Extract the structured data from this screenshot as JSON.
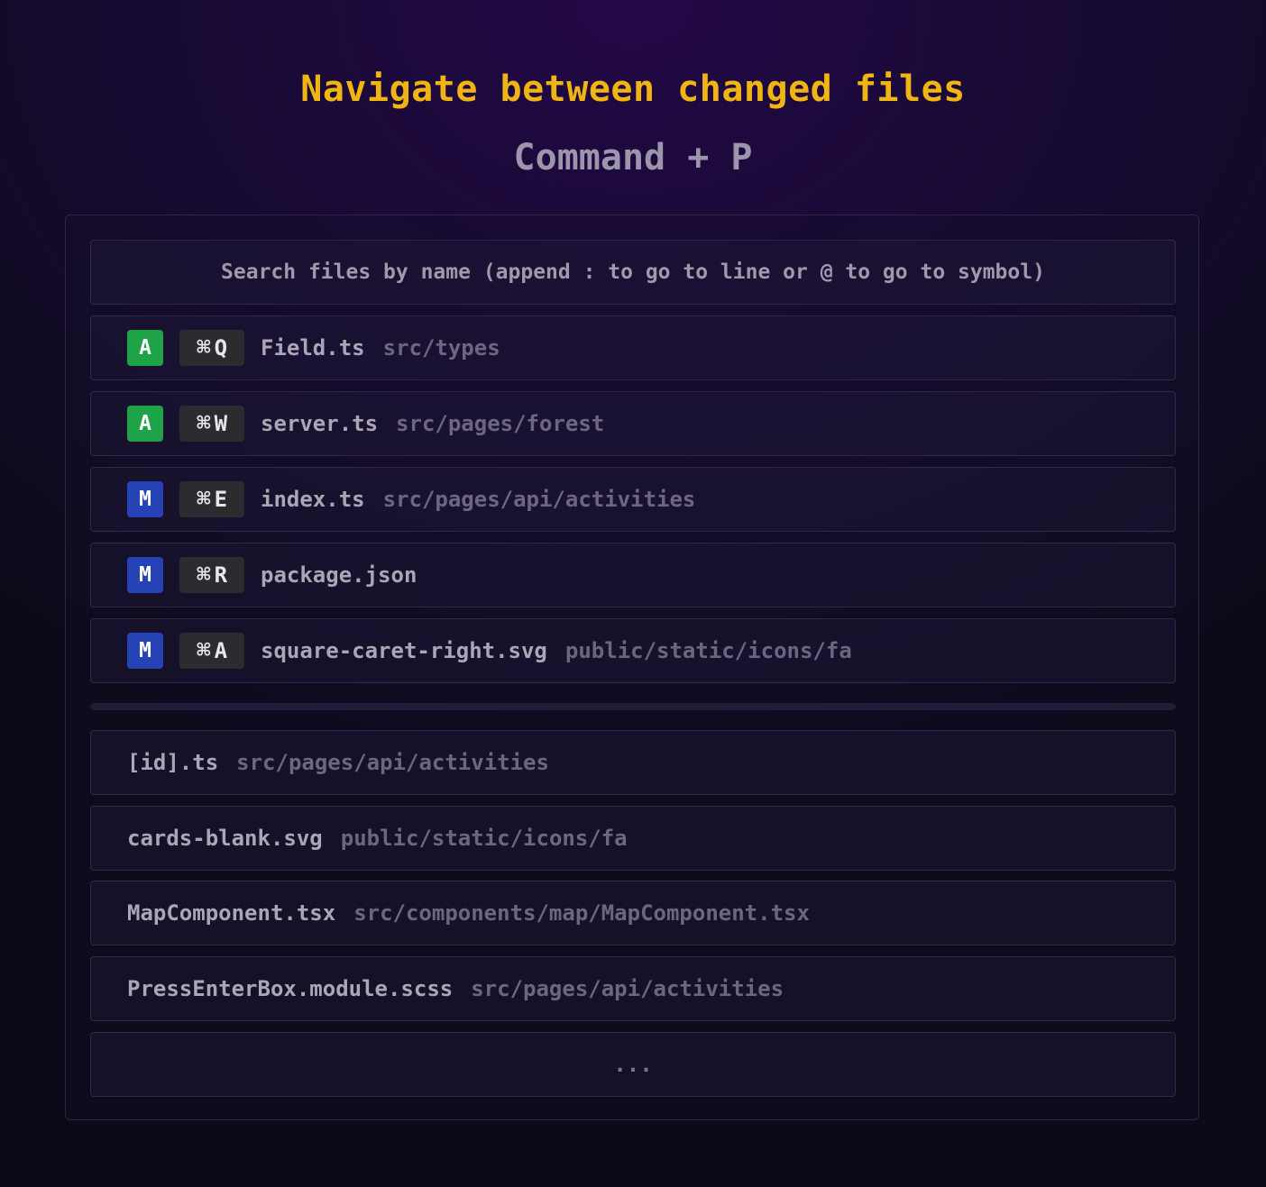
{
  "header": {
    "title": "Navigate between changed files",
    "shortcut": "Command + P"
  },
  "search": {
    "placeholder": "Search files by name (append : to go to line or @ to go to symbol)"
  },
  "changed_files": [
    {
      "status": "A",
      "status_color": "#1fa348",
      "shortcut_symbol": "⌘",
      "shortcut_key": "Q",
      "name": "Field.ts",
      "path": "src/types"
    },
    {
      "status": "A",
      "status_color": "#1fa348",
      "shortcut_symbol": "⌘",
      "shortcut_key": "W",
      "name": "server.ts",
      "path": "src/pages/forest"
    },
    {
      "status": "M",
      "status_color": "#2543b4",
      "shortcut_symbol": "⌘",
      "shortcut_key": "E",
      "name": "index.ts",
      "path": "src/pages/api/activities"
    },
    {
      "status": "M",
      "status_color": "#2543b4",
      "shortcut_symbol": "⌘",
      "shortcut_key": "R",
      "name": "package.json",
      "path": ""
    },
    {
      "status": "M",
      "status_color": "#2543b4",
      "shortcut_symbol": "⌘",
      "shortcut_key": "A",
      "name": "square-caret-right.svg",
      "path": "public/static/icons/fa"
    }
  ],
  "other_files": [
    {
      "name": "[id].ts",
      "path": "src/pages/api/activities"
    },
    {
      "name": "cards-blank.svg",
      "path": "public/static/icons/fa"
    },
    {
      "name": "MapComponent.tsx",
      "path": "src/components/map/MapComponent.tsx"
    },
    {
      "name": "PressEnterBox.module.scss",
      "path": "src/pages/api/activities"
    }
  ],
  "more_label": "...",
  "colors": {
    "title": "#f0b512",
    "added": "#1fa348",
    "modified": "#2543b4"
  }
}
